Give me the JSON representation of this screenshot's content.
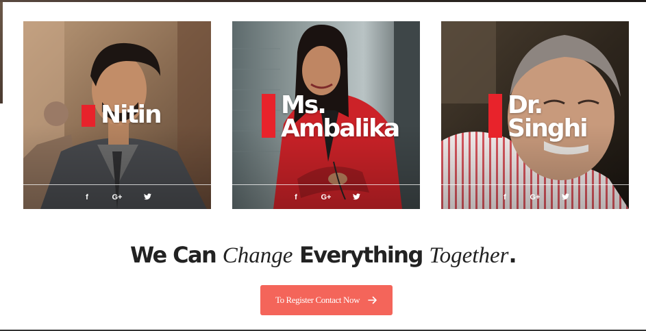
{
  "team": [
    {
      "name_lines": [
        "Nitin"
      ],
      "socials": [
        "f",
        "G+",
        "t"
      ]
    },
    {
      "name_lines": [
        "Ms.",
        "Ambalika"
      ],
      "socials": [
        "f",
        "G+",
        "t"
      ]
    },
    {
      "name_lines": [
        "Dr.",
        "Singhi"
      ],
      "socials": [
        "f",
        "G+",
        "t"
      ]
    }
  ],
  "tagline": {
    "part1": "We Can ",
    "part2": "Change",
    "part3": " Everything ",
    "part4": "Together",
    "part5": "."
  },
  "cta": {
    "label": "To Register Contact Now"
  },
  "colors": {
    "accent_red": "#e8232b",
    "button": "#f4655a",
    "heading": "#222222"
  }
}
